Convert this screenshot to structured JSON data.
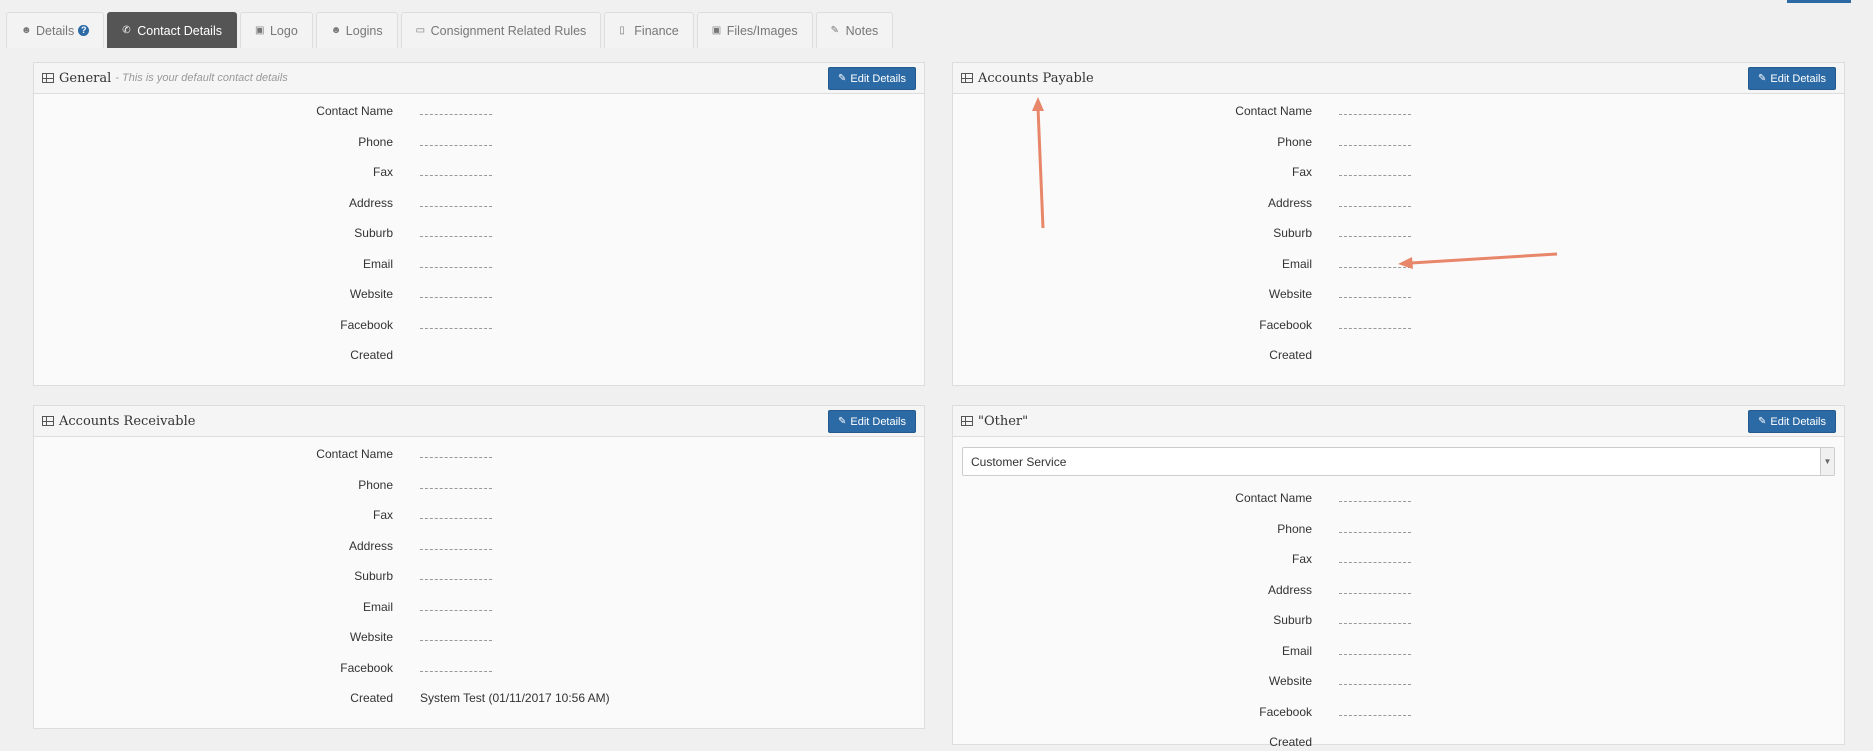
{
  "tabs": [
    {
      "label": "Details",
      "icon": "user-icon",
      "active": false
    },
    {
      "label": "Contact Details",
      "icon": "phone-icon",
      "active": true
    },
    {
      "label": "Logo",
      "icon": "image-icon",
      "active": false
    },
    {
      "label": "Logins",
      "icon": "users-icon",
      "active": false
    },
    {
      "label": "Consignment Related Rules",
      "icon": "document-icon",
      "active": false
    },
    {
      "label": "Finance",
      "icon": "folder-icon",
      "active": false
    },
    {
      "label": "Files/Images",
      "icon": "file-image-icon",
      "active": false
    },
    {
      "label": "Notes",
      "icon": "pencil-icon",
      "active": false
    }
  ],
  "edit_label": "Edit Details",
  "field_labels": [
    "Contact Name",
    "Phone",
    "Fax",
    "Address",
    "Suburb",
    "Email",
    "Website",
    "Facebook",
    "Created"
  ],
  "general": {
    "title": "General",
    "subtitle": "- This is your default contact details",
    "created_value": ""
  },
  "payable": {
    "title": "Accounts Payable",
    "created_value": ""
  },
  "receivable": {
    "title": "Accounts Receivable",
    "created_value": "System Test (01/11/2017 10:56 AM)"
  },
  "other": {
    "title": "\"Other\"",
    "select_value": "Customer Service",
    "created_value": ""
  },
  "colors": {
    "accent": "#2b6aa5",
    "active_tab": "#555555",
    "annotation_arrow": "#e8866a"
  }
}
